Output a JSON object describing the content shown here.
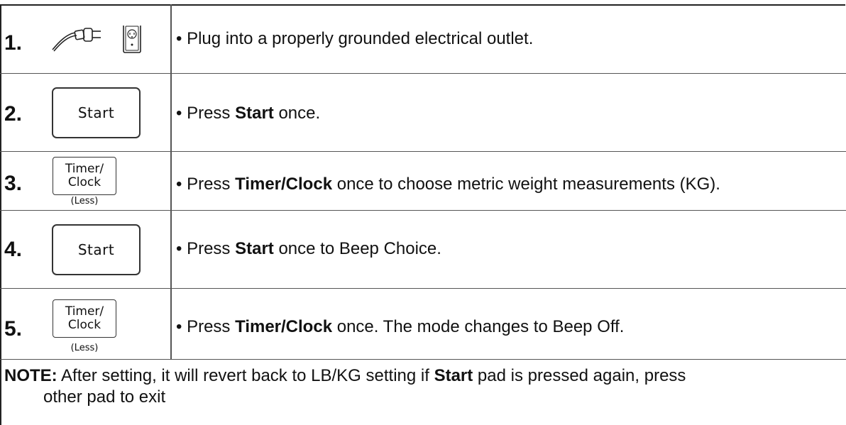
{
  "steps": [
    {
      "number": "1.",
      "desc_before": "• Plug into a properly grounded electrical outlet.",
      "desc_bold": "",
      "desc_after": ""
    },
    {
      "number": "2.",
      "pad_label": "Start",
      "desc_before": "• Press ",
      "desc_bold": "Start",
      "desc_after": " once."
    },
    {
      "number": "3.",
      "pad_line1": "Timer/",
      "pad_line2": "Clock",
      "pad_sub": "(Less)",
      "desc_before": "• Press ",
      "desc_bold": "Timer/Clock",
      "desc_after": " once to choose metric weight measurements (KG)."
    },
    {
      "number": "4.",
      "pad_label": "Start",
      "desc_before": "• Press ",
      "desc_bold": "Start",
      "desc_after": " once to Beep Choice."
    },
    {
      "number": "5.",
      "pad_line1": "Timer/",
      "pad_line2": "Clock",
      "pad_sub": "(Less)",
      "desc_before": "• Press ",
      "desc_bold": "Timer/Clock",
      "desc_after": " once. The mode changes to Beep Off."
    }
  ],
  "note": {
    "label": "NOTE:",
    "text_before": " After setting, it will revert back to LB/KG setting if ",
    "text_bold": "Start",
    "text_after": " pad is pressed again, press",
    "line2": "other pad to exit"
  },
  "icons": [
    "plug-icon",
    "outlet-icon"
  ]
}
